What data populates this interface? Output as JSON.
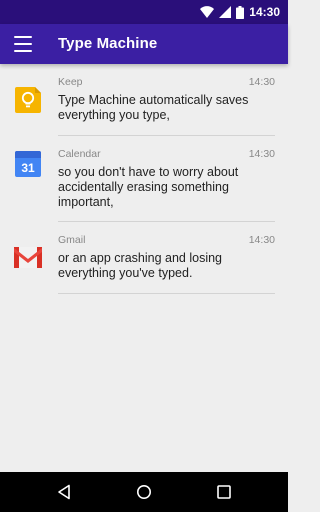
{
  "status_bar": {
    "time": "14:30"
  },
  "app_bar": {
    "title": "Type Machine"
  },
  "items": [
    {
      "app": "Keep",
      "time": "14:30",
      "text": "Type Machine automatically saves everything you type,"
    },
    {
      "app": "Calendar",
      "time": "14:30",
      "text": "so you don't have to worry about accidentally erasing something important,",
      "calendar_day": "31"
    },
    {
      "app": "Gmail",
      "time": "14:30",
      "text": "or an app crashing and losing everything you've typed."
    }
  ],
  "colors": {
    "status_bar": "#2a0f7a",
    "app_bar": "#3b1fa3",
    "background": "#eeeeee"
  }
}
